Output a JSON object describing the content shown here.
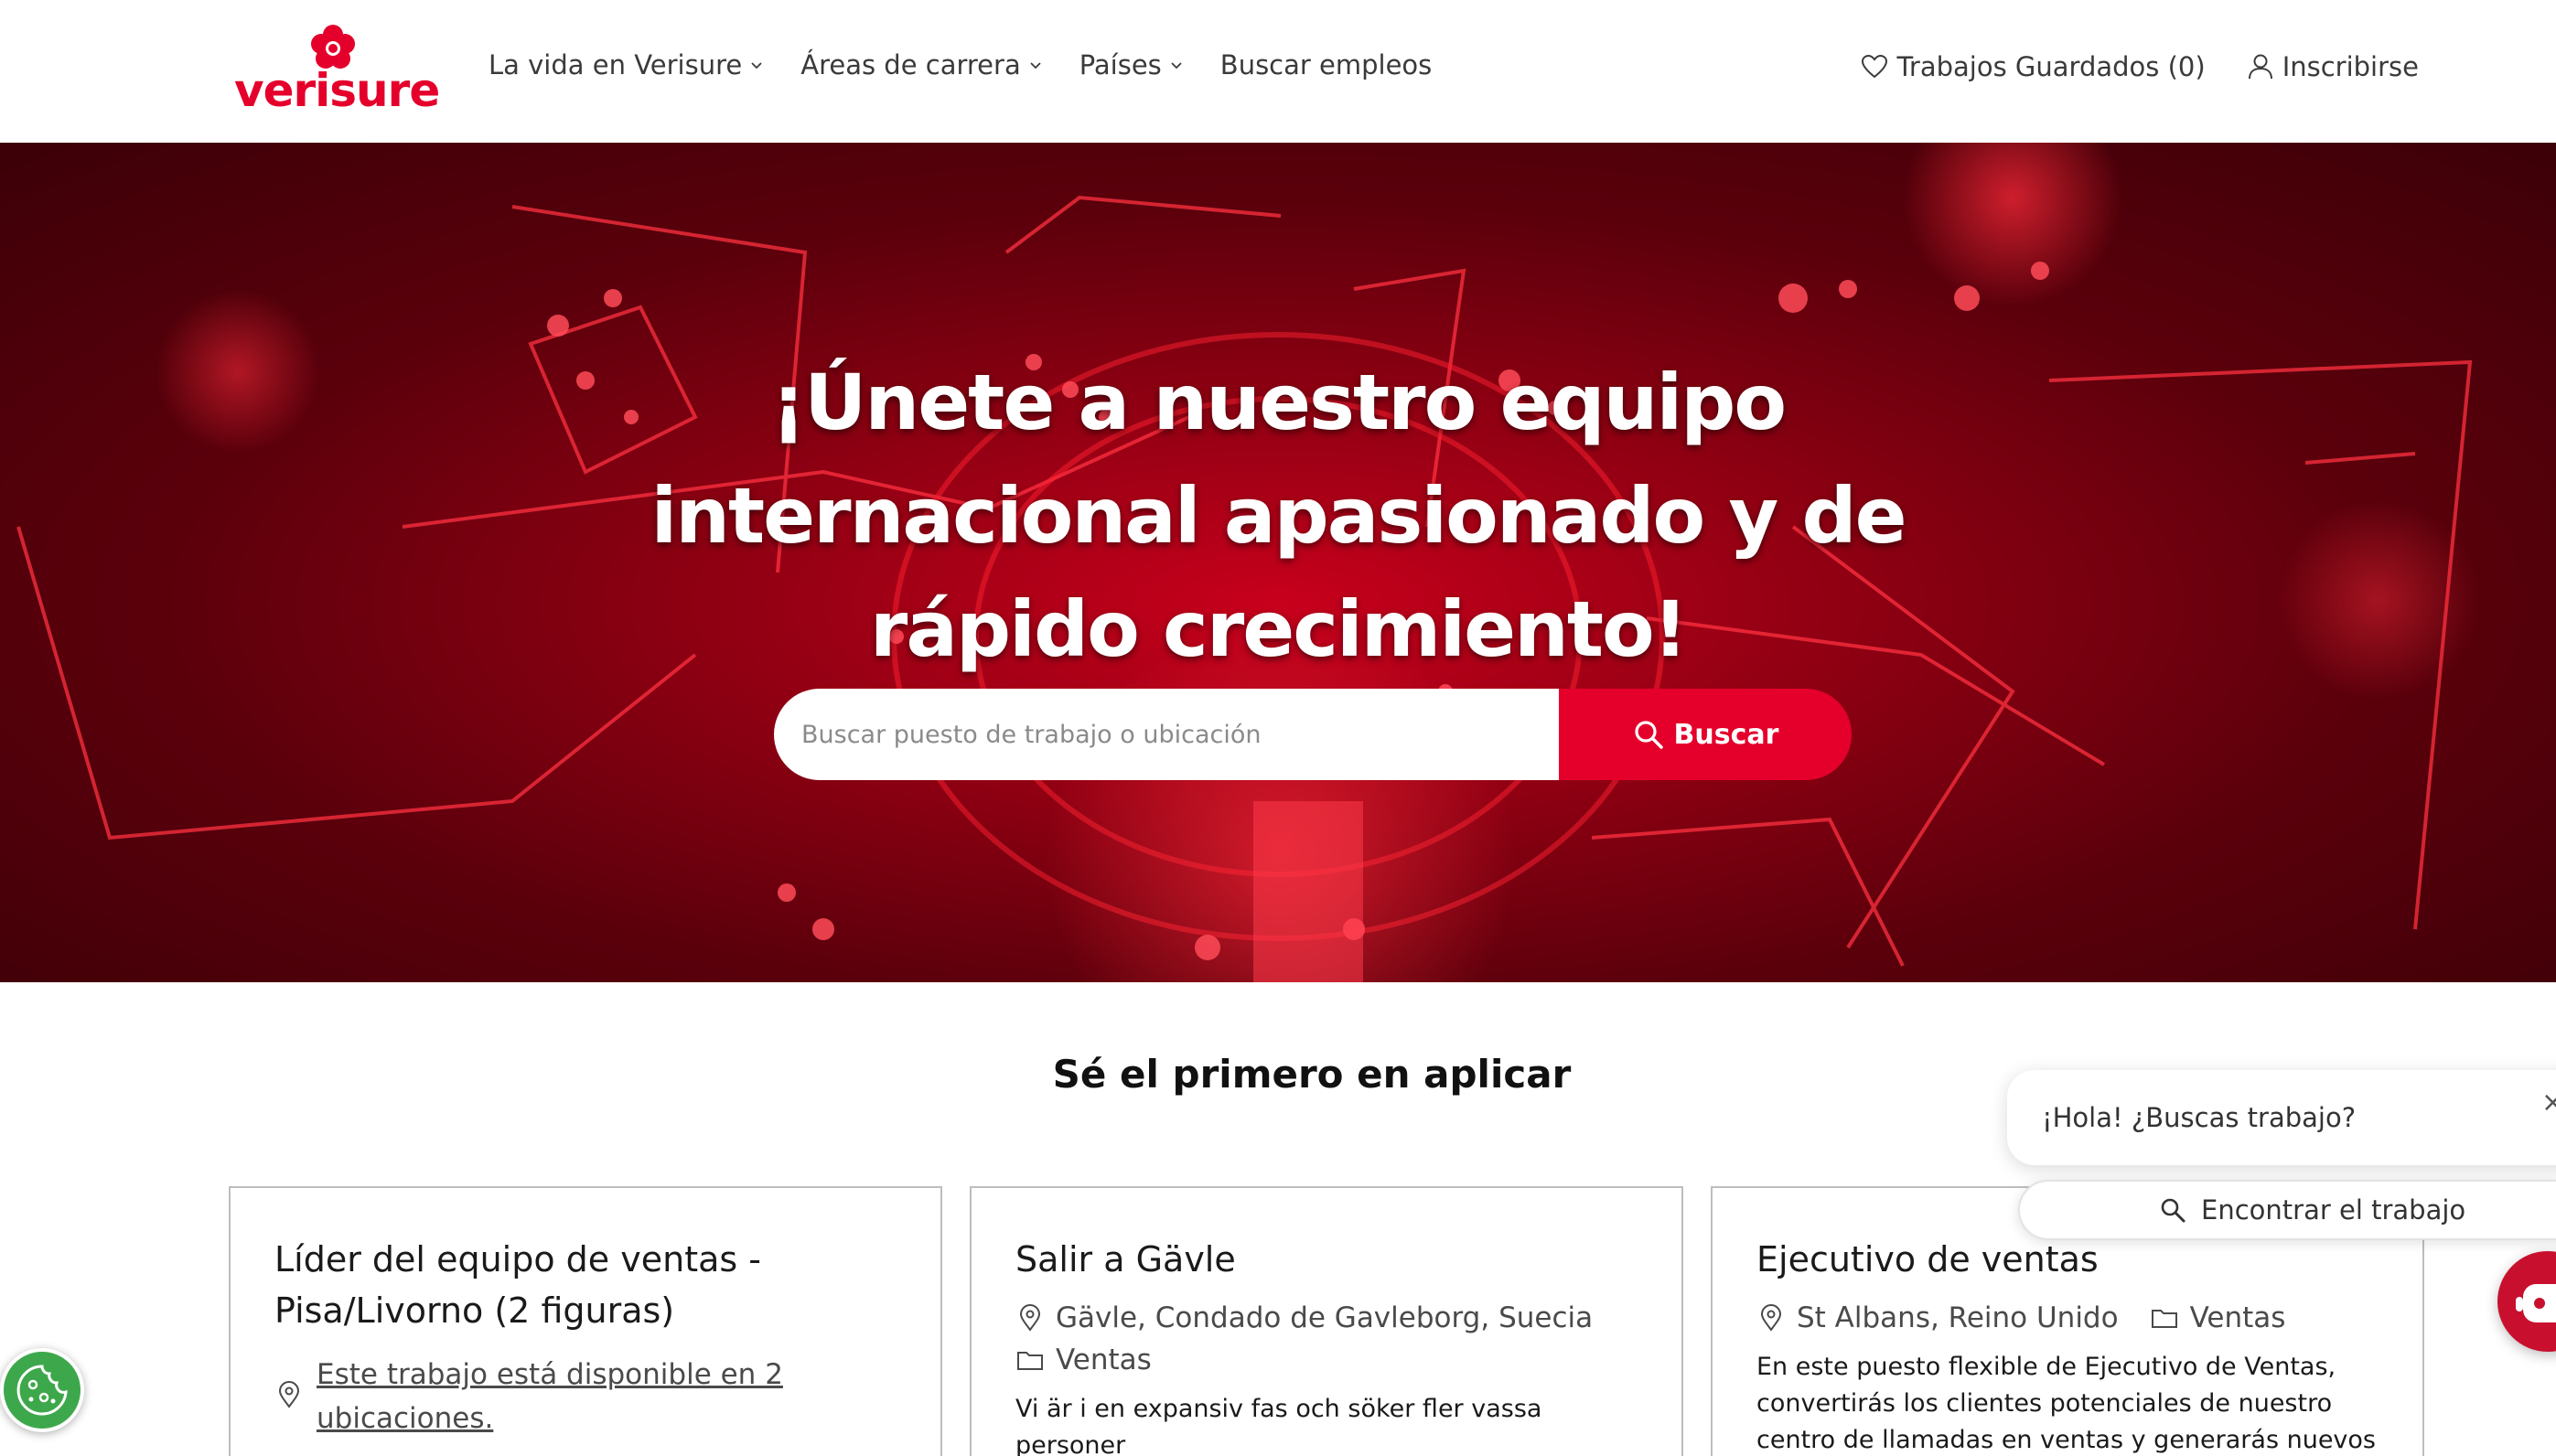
{
  "brand": {
    "name": "verisure",
    "color": "#e4002b"
  },
  "nav": {
    "items": [
      {
        "label": "La vida en Verisure",
        "has_dropdown": true
      },
      {
        "label": "Áreas de carrera",
        "has_dropdown": true
      },
      {
        "label": "Países",
        "has_dropdown": true
      },
      {
        "label": "Buscar empleos",
        "has_dropdown": false
      }
    ],
    "saved_jobs": "Trabajos Guardados (0)",
    "signup": "Inscribirse"
  },
  "hero": {
    "title": "¡Únete a nuestro equipo internacional apasionado y de rápido crecimiento!",
    "search_placeholder": "Buscar puesto de trabajo o ubicación",
    "search_button": "Buscar"
  },
  "section": {
    "title": "Sé el primero en aplicar"
  },
  "jobs": [
    {
      "title": "Líder del equipo de ventas - Pisa/Livorno (2 figuras)",
      "multi_location": "Este trabajo está disponible en 2 ubicaciones."
    },
    {
      "title": "Salir a Gävle",
      "location": "Gävle, Condado de Gavleborg, Suecia",
      "category": "Ventas",
      "description": "Vi är i en expansiv fas och söker fler vassa personer"
    },
    {
      "title": "Ejecutivo de ventas",
      "location": "St Albans, Reino Unido",
      "category": "Ventas",
      "description": "En este puesto flexible de Ejecutivo de Ventas, convertirás los clientes potenciales de nuestro centro de llamadas en ventas y generarás nuevos"
    }
  ],
  "chat": {
    "greeting": "¡Hola! ¿Buscas trabajo?",
    "find_button": "Encontrar el trabajo",
    "close": "×"
  }
}
